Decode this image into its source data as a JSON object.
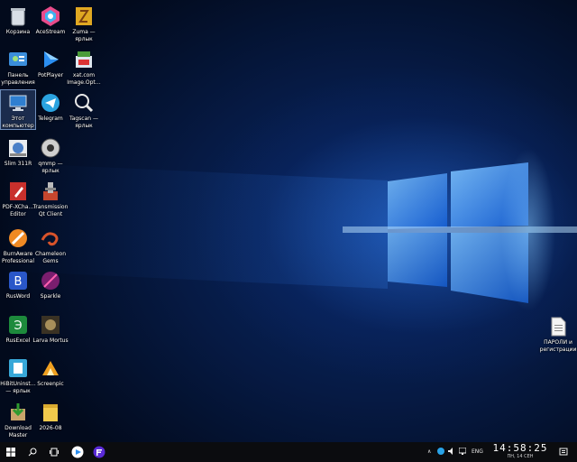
{
  "desktop": {
    "icons": [
      {
        "label": "Корзина",
        "icon": "recycle-bin-icon"
      },
      {
        "label": "Панель управления",
        "icon": "control-panel-icon"
      },
      {
        "label": "Этот компьютер",
        "icon": "computer-icon"
      },
      {
        "label": "Slim 311R",
        "icon": "scanner-icon"
      },
      {
        "label": "PDF-XCha… Editor",
        "icon": "pdf-editor-icon"
      },
      {
        "label": "BurnAware Professional",
        "icon": "burnaware-icon"
      },
      {
        "label": "RusWord",
        "icon": "rusword-icon"
      },
      {
        "label": "RusExcel",
        "icon": "rusexcel-icon"
      },
      {
        "label": "HiBitUninst… — ярлык",
        "icon": "uninstaller-icon"
      },
      {
        "label": "Download Master",
        "icon": "download-master-icon"
      },
      {
        "label": "AceStream",
        "icon": "acestream-icon"
      },
      {
        "label": "PotPlayer",
        "icon": "potplayer-icon"
      },
      {
        "label": "Telegram",
        "icon": "telegram-icon"
      },
      {
        "label": "qmmp — ярлык",
        "icon": "qmmp-icon"
      },
      {
        "label": "Transmission Qt Client",
        "icon": "transmission-icon"
      },
      {
        "label": "Chameleon Gems",
        "icon": "chameleon-icon"
      },
      {
        "label": "Sparkle",
        "icon": "sparkle-icon"
      },
      {
        "label": "Larva Mortus",
        "icon": "larva-mortus-icon"
      },
      {
        "label": "Screenpic",
        "icon": "screenpic-icon"
      },
      {
        "label": "2026-08",
        "icon": "folder-icon"
      },
      {
        "label": "Zuma — ярлык",
        "icon": "zuma-icon"
      },
      {
        "label": "xat.com Image.Opt…",
        "icon": "image-optimizer-icon"
      },
      {
        "label": "Tagscan — ярлык",
        "icon": "tagscan-icon"
      },
      {
        "label": "ПАРОЛИ и регистрации",
        "icon": "text-file-icon"
      }
    ]
  },
  "taskbar": {
    "start": "windows-start-icon",
    "search": "search-icon",
    "taskview": "task-view-icon",
    "app1": "media-player-taskbar-icon",
    "app2": "app-taskbar-icon",
    "lang": "ENG",
    "time": "14:58:25",
    "date": "ПН, 14 СЕН"
  },
  "colors": {
    "taskbar": "#0b0c0f",
    "accent": "#2a7bff"
  }
}
